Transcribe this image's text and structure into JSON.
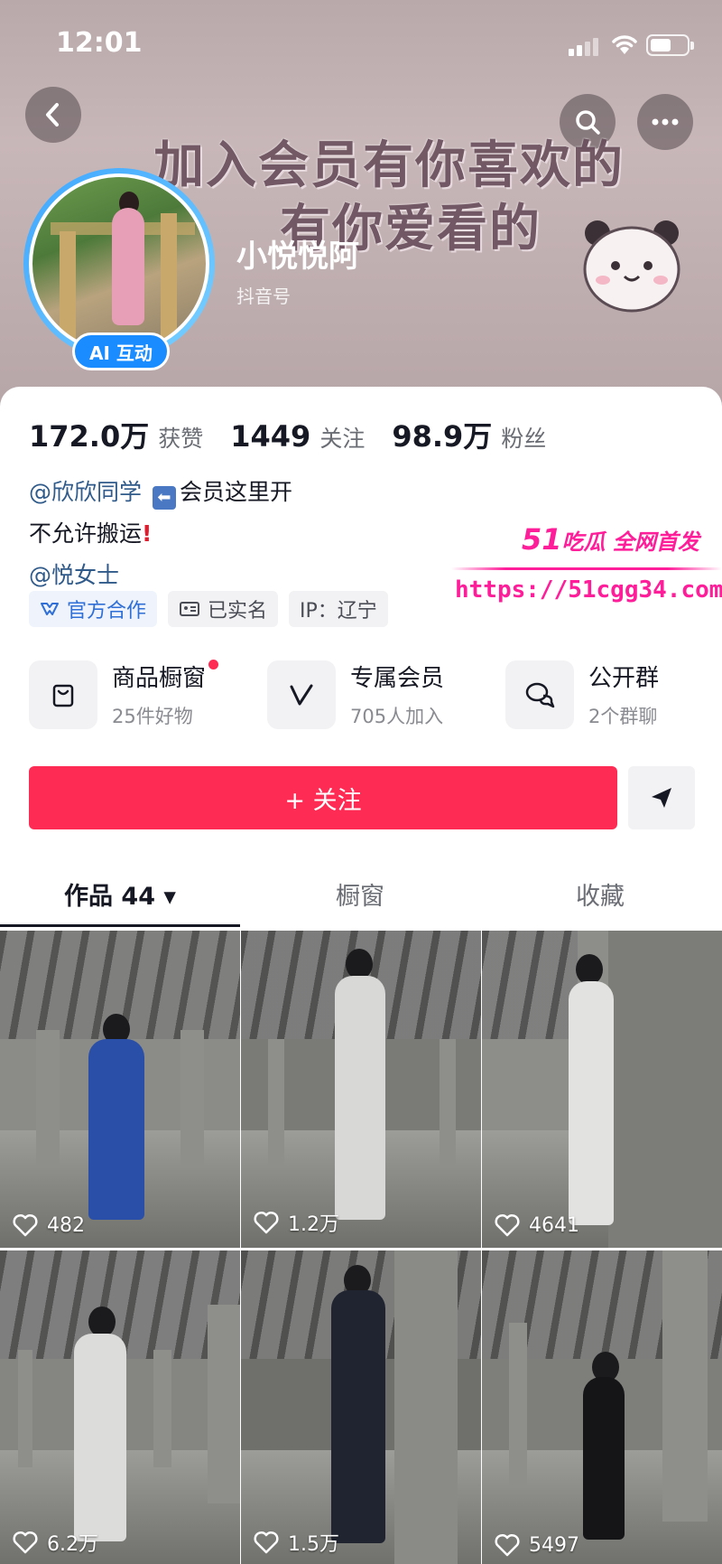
{
  "status_bar": {
    "time": "12:01"
  },
  "banner": {
    "title_line1": "加入会员有你喜欢的",
    "title_line2": "有你爱看的"
  },
  "profile": {
    "ai_badge": "AI 互动",
    "nickname": "小悦悦阿",
    "id_label": "抖音号"
  },
  "stats": [
    {
      "value": "172.0万",
      "label": "获赞"
    },
    {
      "value": "1449",
      "label": "关注"
    },
    {
      "value": "98.9万",
      "label": "粉丝"
    }
  ],
  "bio": {
    "line1_mention": "@欣欣同学",
    "line1_text": "会员这里开",
    "line2_text": "不允许搬运",
    "line3_mention": "@悦女士"
  },
  "tags": [
    {
      "label": "官方合作",
      "icon": "handshake-icon"
    },
    {
      "label": "已实名",
      "icon": "id-card-icon"
    },
    {
      "label": "IP：辽宁"
    }
  ],
  "features": [
    {
      "title": "商品橱窗",
      "subtitle": "25件好物",
      "icon": "shopping-bag-icon"
    },
    {
      "title": "专属会员",
      "subtitle": "705人加入",
      "icon": "vip-v-icon"
    },
    {
      "title": "公开群",
      "subtitle": "2个群聊",
      "icon": "chat-bubbles-icon"
    }
  ],
  "follow_button": "+ 关注",
  "tabs": [
    {
      "label": "作品 44 ▾",
      "active": true
    },
    {
      "label": "橱窗",
      "active": false
    },
    {
      "label": "收藏",
      "active": false
    }
  ],
  "videos": [
    {
      "likes": "482"
    },
    {
      "likes": "1.2万"
    },
    {
      "likes": "4641"
    },
    {
      "likes": "6.2万"
    },
    {
      "likes": "1.5万"
    },
    {
      "likes": "5497"
    }
  ],
  "watermark": {
    "brand_num": "51",
    "brand_text": "吃瓜 全网首发",
    "url": "https://51cgg34.com"
  },
  "colors": {
    "accent": "#fe2c55",
    "link": "#2f5a8a",
    "ai_badge": "#1a8cff",
    "watermark": "#ff1e9a"
  }
}
